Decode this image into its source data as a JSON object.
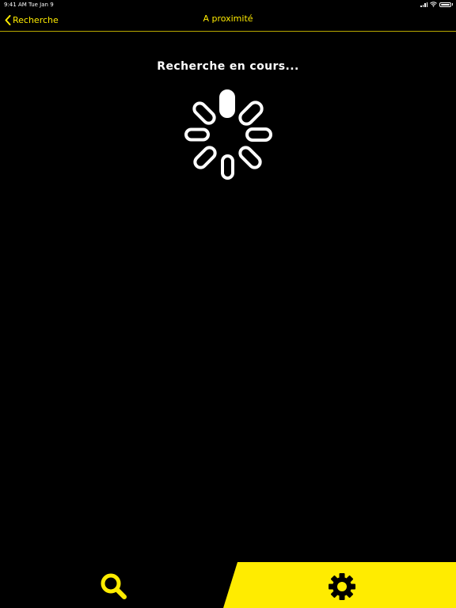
{
  "status_bar": {
    "time": "9:41 AM",
    "date": "Tue Jan 9",
    "icons": [
      "signal-icon",
      "wifi-icon",
      "battery-icon"
    ]
  },
  "nav": {
    "back_label": "Recherche",
    "title": "A proximité"
  },
  "content": {
    "loading_text": "Recherche en cours..."
  },
  "tab_bar": {
    "tabs": [
      {
        "icon": "search-icon",
        "selected": true
      },
      {
        "icon": "gear-icon",
        "selected": false
      }
    ]
  },
  "colors": {
    "background": "#000000",
    "accent": "#ffec00",
    "text": "#ffffff"
  }
}
